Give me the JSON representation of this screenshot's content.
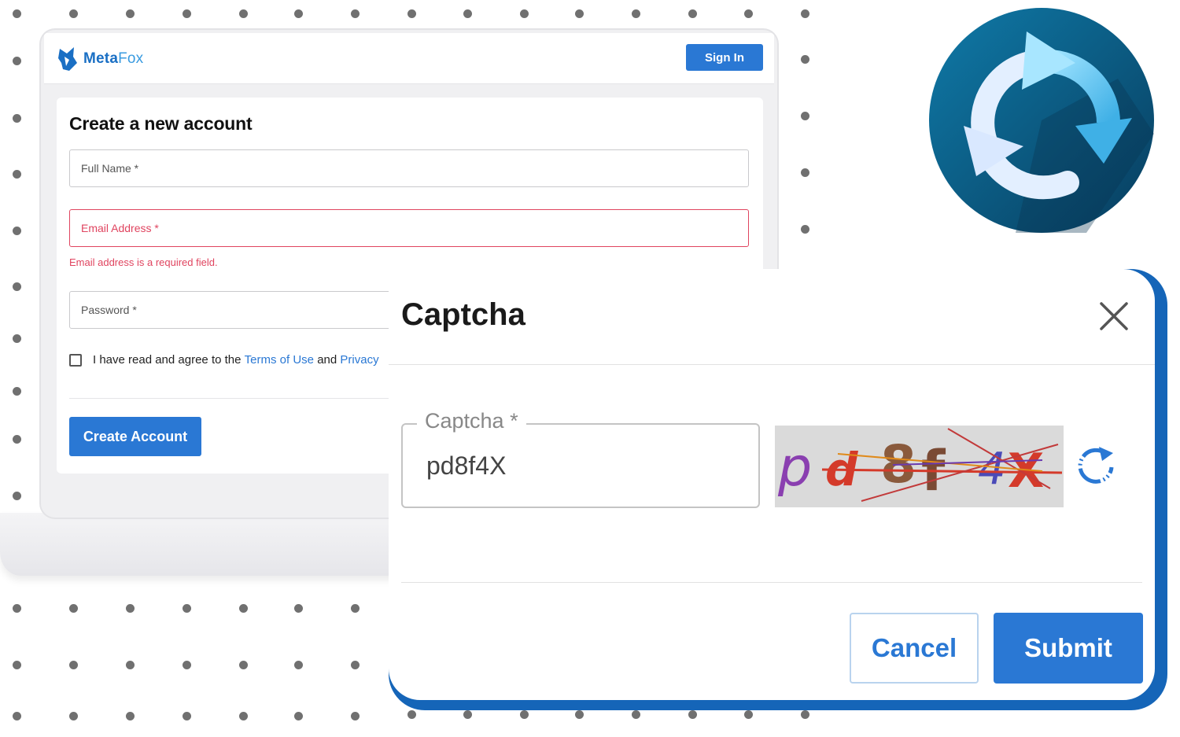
{
  "app": {
    "logo_bold": "Meta",
    "logo_light": "Fox",
    "signin_label": "Sign In"
  },
  "signup_form": {
    "title": "Create a new account",
    "fields": [
      {
        "placeholder": "Full Name *",
        "state": "normal"
      },
      {
        "placeholder": "Email Address *",
        "state": "error"
      },
      {
        "placeholder": "Password *",
        "state": "normal"
      }
    ],
    "email_error": "Email address is a required field.",
    "agree_prefix": "I have read and agree to the",
    "terms_label": "Terms of Use",
    "and_label": "and",
    "privacy_label": "Privacy",
    "agree_checked": false,
    "create_label": "Create Account"
  },
  "captcha_dialog": {
    "title": "Captcha",
    "field_label": "Captcha *",
    "field_value": "pd8f4X",
    "image_chars": [
      "p",
      "d",
      "8",
      "f",
      "4",
      "X"
    ],
    "cancel_label": "Cancel",
    "submit_label": "Submit"
  },
  "icons": {
    "logo": "fox-logo-icon",
    "refresh_badge": "refresh-arrows-icon",
    "close": "close-icon",
    "reload": "reload-icon",
    "checkbox": "checkbox-icon"
  },
  "colors": {
    "primary": "#2a78d4",
    "error": "#e0445f",
    "dialog_accent": "#1565b8",
    "badge": "#0b4a6e"
  }
}
